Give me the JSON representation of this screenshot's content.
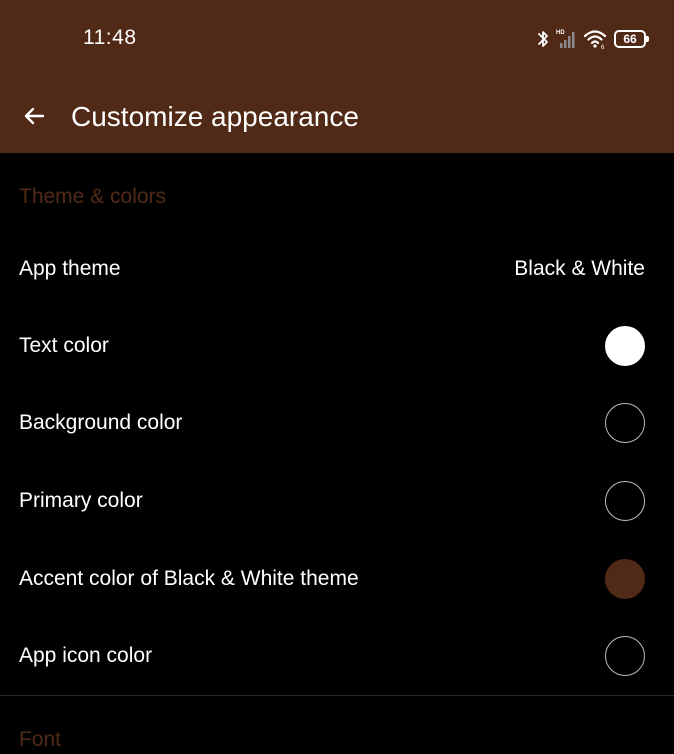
{
  "status_bar": {
    "time": "11:48",
    "battery_level": "66",
    "network_label": "HD"
  },
  "app_bar": {
    "title": "Customize appearance",
    "color": "#512a17"
  },
  "sections": {
    "theme": {
      "header": "Theme & colors"
    },
    "font": {
      "header": "Font"
    }
  },
  "settings": {
    "app_theme": {
      "label": "App theme",
      "value": "Black & White"
    },
    "text_color": {
      "label": "Text color",
      "swatch": "#ffffff"
    },
    "background_color": {
      "label": "Background color",
      "swatch": "#000000"
    },
    "primary_color": {
      "label": "Primary color",
      "swatch": "#000000"
    },
    "accent_color": {
      "label": "Accent color of Black & White theme",
      "swatch": "#512a17"
    },
    "app_icon_color": {
      "label": "App icon color",
      "swatch": "#000000"
    }
  }
}
